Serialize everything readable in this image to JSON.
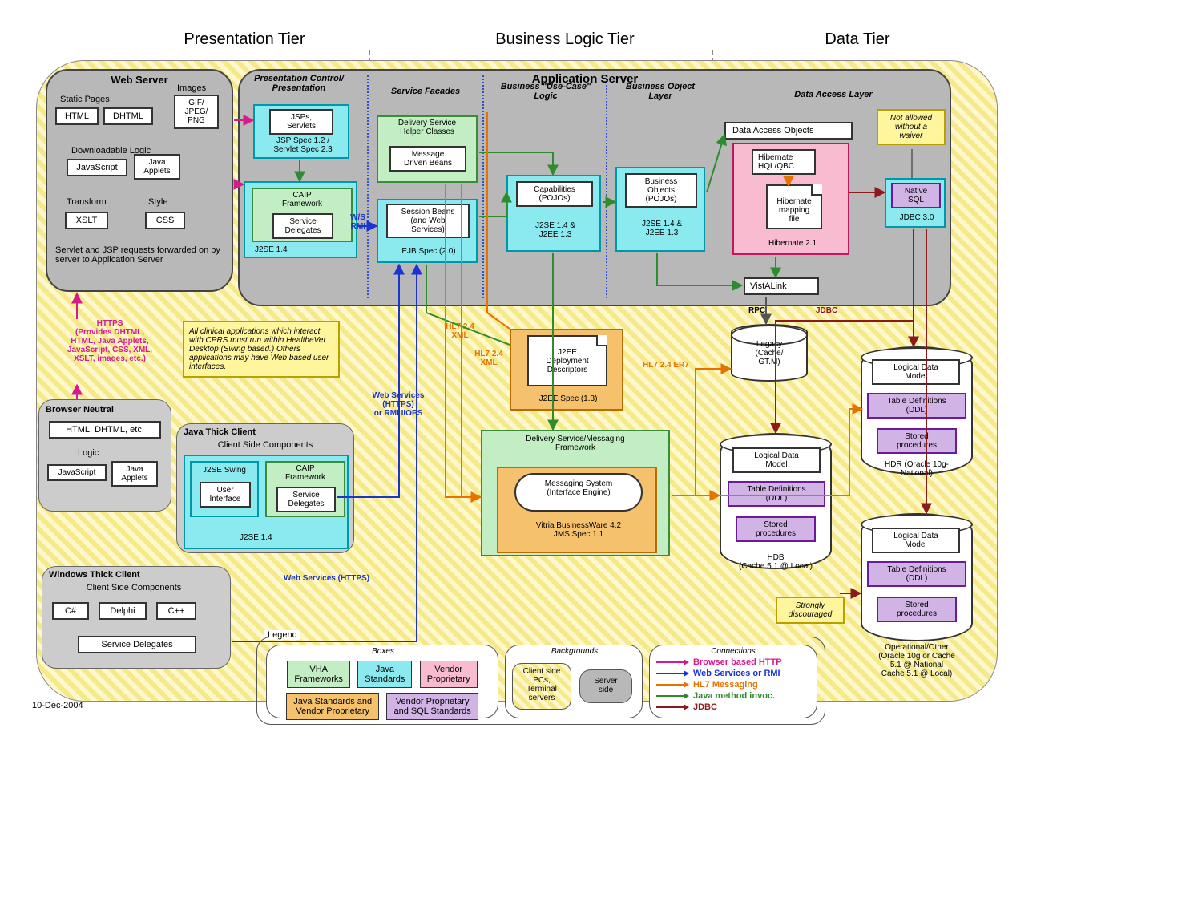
{
  "date": "10-Dec-2004",
  "tiers": {
    "presentation": "Presentation Tier",
    "business": "Business Logic Tier",
    "data": "Data Tier"
  },
  "web_server": {
    "title": "Web Server",
    "static_pages": "Static Pages",
    "html": "HTML",
    "dhtml": "DHTML",
    "images": "Images",
    "images_sub": "GIF/\nJPEG/\nPNG",
    "downloadable": "Downloadable Logic",
    "javascript": "JavaScript",
    "applets": "Java\nApplets",
    "transform": "Transform",
    "xslt": "XSLT",
    "style": "Style",
    "css": "CSS",
    "forward_note": "Servlet and JSP requests forwarded on by server to Application Server"
  },
  "pres_control": {
    "title": "Presentation Control/\nPresentation",
    "jsps": "JSPs,\nServlets",
    "jsp_spec": "JSP Spec 1.2 /\nServlet Spec 2.3",
    "caip": "CAIP\nFramework",
    "delegates": "Service\nDelegates",
    "j2se": "J2SE 1.4"
  },
  "ws_rmi": "W/S\nRMI",
  "app_server": {
    "title": "Application Server",
    "facades": "Service Facades",
    "usecase": "Business \"Use-Case\"\nLogic",
    "bobj": "Business Object\nLayer",
    "dal": "Data Access Layer",
    "dshc": "Delivery Service\nHelper Classes",
    "mdb": "Message\nDriven Beans",
    "session": "Session Beans\n(and Web\nServices)",
    "ejb_spec": "EJB Spec (2.0)",
    "caps": "Capabilities\n(POJOs)",
    "bobjs": "Business\nObjects\n(POJOs)",
    "j2se_ee": "J2SE 1.4 &\nJ2EE 1.3",
    "dao": "Data Access Objects",
    "hib_hql": "Hibernate\nHQL/QBC",
    "hib_map": "Hibernate\nmapping\nfile",
    "hib_ver": "Hibernate 2.1",
    "vistalink": "VistALink",
    "native_sql": "Native\nSQL",
    "jdbc30": "JDBC 3.0",
    "waiver": "Not allowed\nwithout a\nwaiver"
  },
  "https_note": "HTTPS\n(Provides DHTML,\nHTML, Java Applets,\nJavaScript, CSS, XML,\nXSLT, images, etc.)",
  "cprs_note": "All clinical applications which interact with CPRS  must run within HealtheVet Desktop (Swing based.) Others applications may have Web based user interfaces.",
  "browser_neutral": {
    "title": "Browser Neutral",
    "html": "HTML, DHTML, etc.",
    "logic": "Logic",
    "javascript": "JavaScript",
    "applets": "Java\nApplets"
  },
  "java_thick": {
    "title": "Java Thick Client",
    "sub": "Client Side Components",
    "swing": "J2SE Swing",
    "ui": "User\nInterface",
    "caip": "CAIP\nFramework",
    "delegates": "Service\nDelegates",
    "j2se": "J2SE 1.4"
  },
  "win_thick": {
    "title": "Windows Thick Client",
    "sub": "Client Side Components",
    "csharp": "C#",
    "delphi": "Delphi",
    "cpp": "C++",
    "delegates": "Service Delegates"
  },
  "ws_label1": "Web Services\n(HTTPS)\nor RMI IIOPS",
  "ws_label2": "Web Services (HTTPS)",
  "hl7_xml": "HL7 2.4\nXML",
  "hl7_er7": "HL7 2.4 ER7",
  "j2ee_dd": {
    "title": "J2EE\nDeployment\nDescriptors",
    "spec": "J2EE Spec (1.3)"
  },
  "messaging": {
    "title": "Delivery Service/Messaging\nFramework",
    "msg_sys": "Messaging System\n(Interface Engine)",
    "vitria": "Vitria BusinessWare 4.2\nJMS Spec 1.1"
  },
  "rpc": "RPC",
  "jdbc": "JDBC",
  "legacy": "Legacy\n(Cache/\nGT.M)",
  "hdb": {
    "ldm": "Logical Data\nModel",
    "ddl": "Table Definitions\n(DDL)",
    "sp": "Stored\nprocedures",
    "label": "HDB\n(Cache 5.1 @ Local)"
  },
  "hdr": {
    "ldm": "Logical Data\nModel",
    "ddl": "Table Definitions\n(DDL)",
    "sp": "Stored\nprocedures",
    "label": "HDR (Oracle 10g-\nNational)"
  },
  "other": {
    "ldm": "Logical Data\nModel",
    "ddl": "Table Definitions\n(DDL)",
    "sp": "Stored\nprocedures",
    "label": "Operational/Other\n(Oracle 10g or Cache\n5.1 @ National\nCache 5.1 @ Local)"
  },
  "discouraged": "Strongly\ndiscouraged",
  "legend": {
    "title": "Legend",
    "boxes": "Boxes",
    "backgrounds": "Backgrounds",
    "connections": "Connections",
    "vha": "VHA\nFrameworks",
    "java_std": "Java\nStandards",
    "vendor_prop": "Vendor\nProprietary",
    "jsvp": "Java Standards and\nVendor Proprietary",
    "vpsql": "Vendor Proprietary\nand SQL Standards",
    "client_bg": "Client side\nPCs,\nTerminal\nservers",
    "server_bg": "Server\nside",
    "conn_http": "Browser based HTTP",
    "conn_ws": "Web Services or RMI",
    "conn_hl7": "HL7 Messaging",
    "conn_java": "Java method invoc.",
    "conn_jdbc": "JDBC"
  }
}
